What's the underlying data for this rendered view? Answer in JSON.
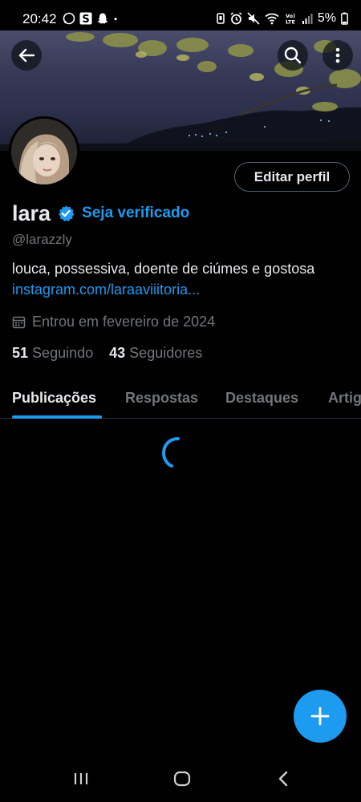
{
  "status_bar": {
    "time": "20:42",
    "battery": "5%",
    "icons": [
      "whatsapp-icon",
      "s-app-icon",
      "snapchat-icon",
      "dot-icon",
      "vibrate-icon",
      "alarm-icon",
      "mute-icon",
      "wifi-icon",
      "volte-icon",
      "signal-icon",
      "battery-icon"
    ]
  },
  "profile": {
    "name": "lara",
    "verify_cta": "Seja verificado",
    "handle": "@larazzly",
    "bio": "louca,  possessiva, doente de ciúmes e gostosa",
    "link": "instagram.com/laraaviiitoria...",
    "joined": "Entrou em fevereiro de 2024",
    "following_count": "51",
    "following_label": "Seguindo",
    "followers_count": "43",
    "followers_label": "Seguidores"
  },
  "actions": {
    "edit_profile": "Editar perfil"
  },
  "tabs": [
    {
      "label": "Publicações",
      "active": true
    },
    {
      "label": "Respostas",
      "active": false
    },
    {
      "label": "Destaques",
      "active": false
    },
    {
      "label": "Artigos",
      "active": false
    }
  ],
  "colors": {
    "accent": "#1d9bf0",
    "background": "#000000",
    "secondary_text": "#71767b"
  }
}
